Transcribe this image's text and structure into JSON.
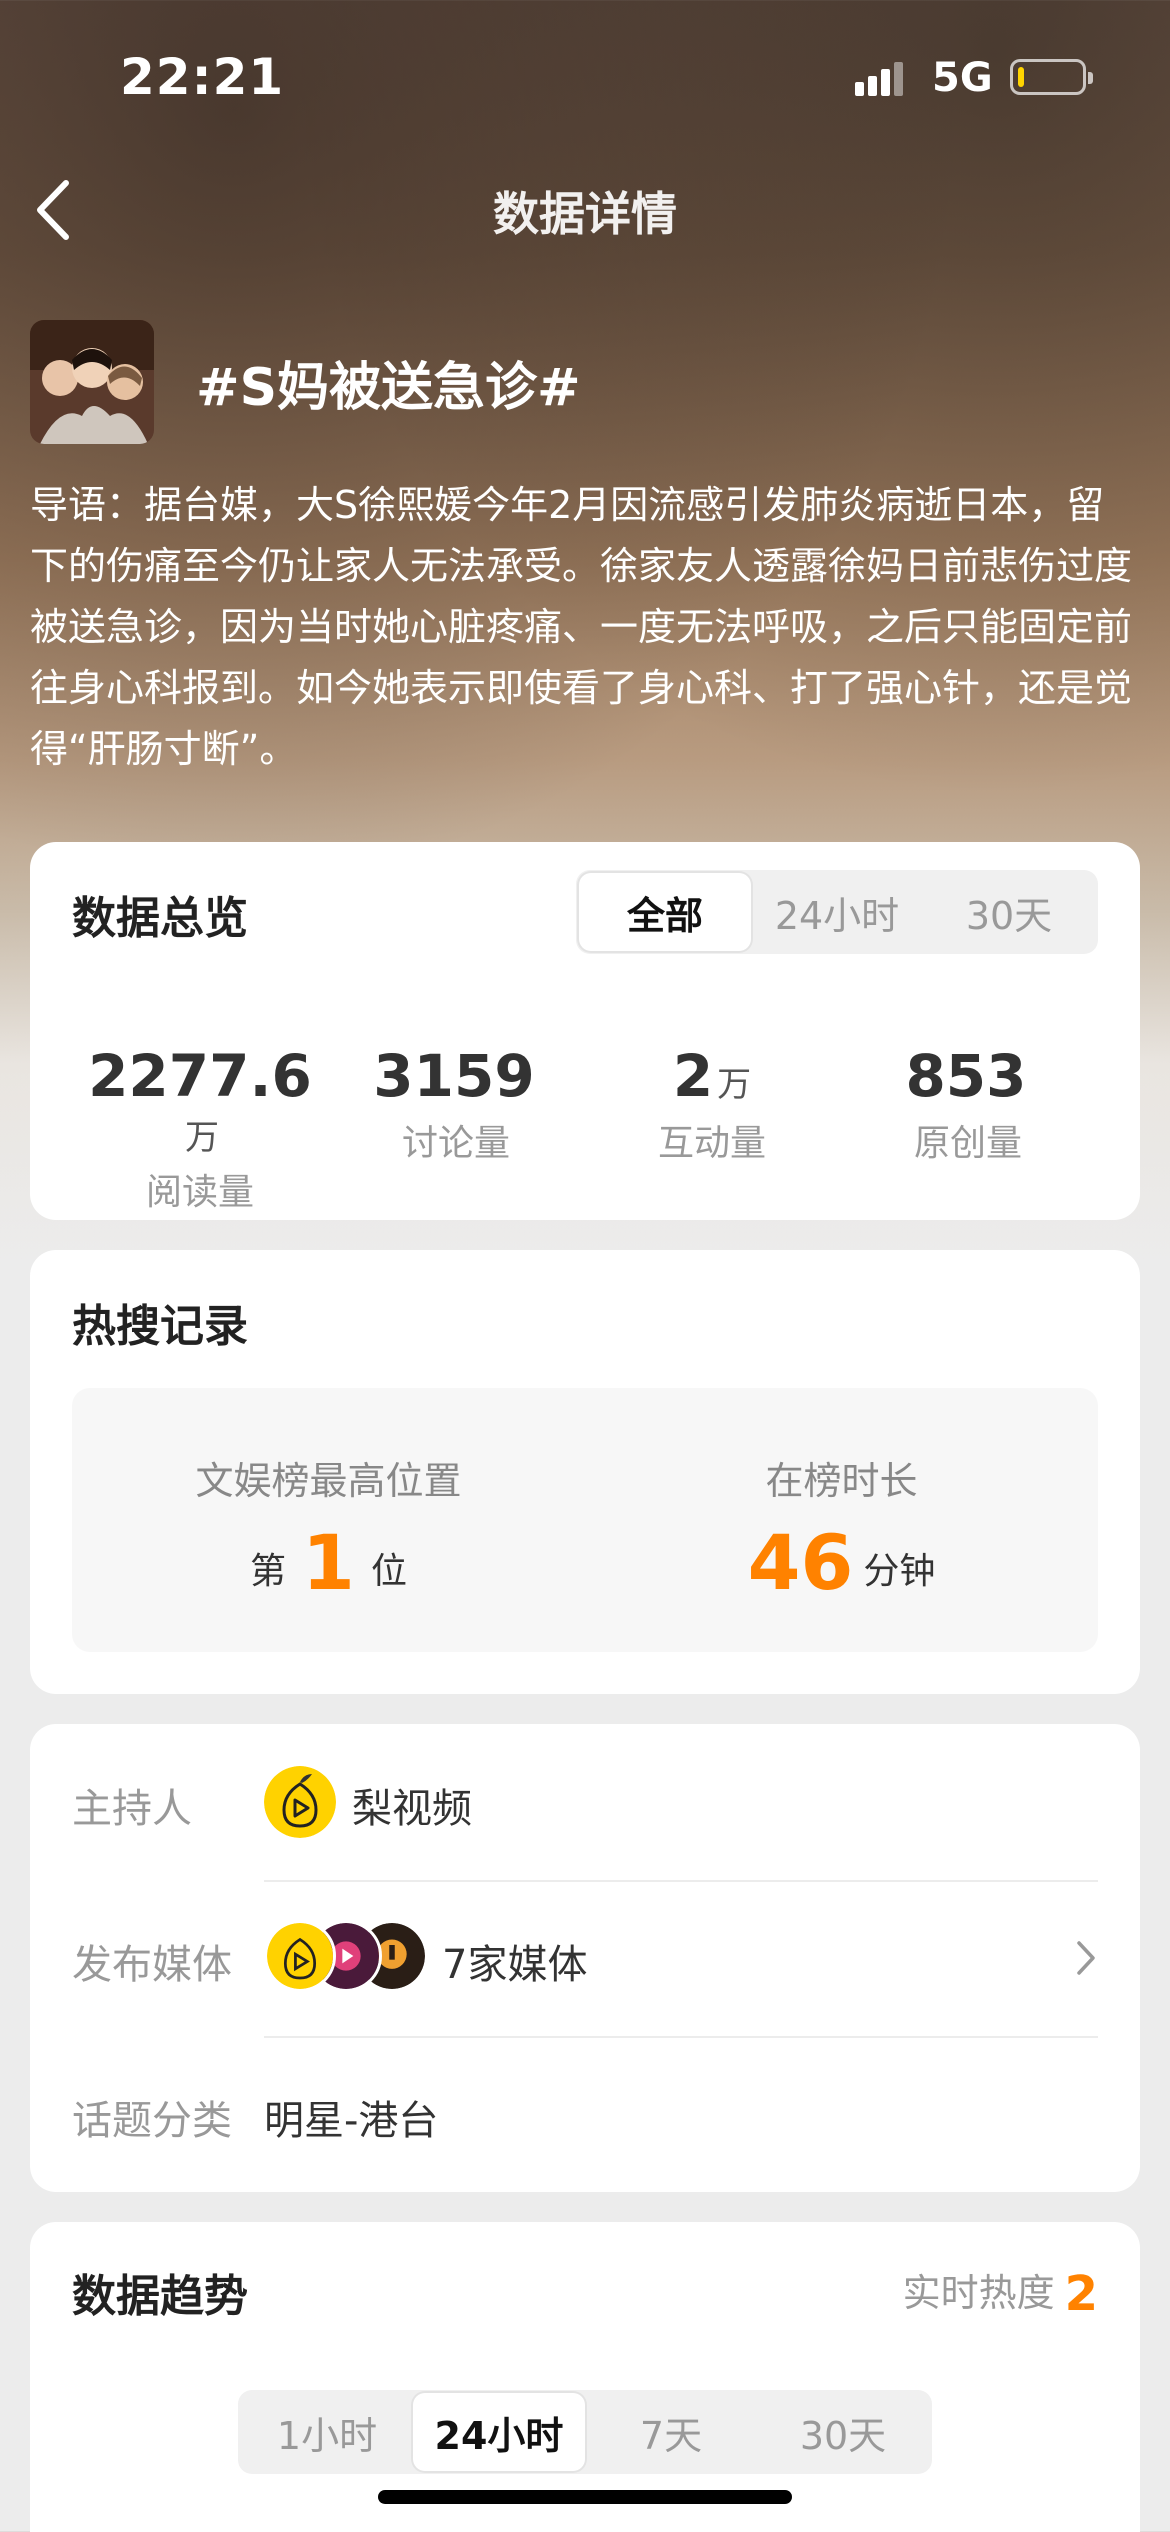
{
  "status_bar": {
    "time": "22:21",
    "network": "5G",
    "battery_level": 0.1
  },
  "nav": {
    "title": "数据详情"
  },
  "topic": {
    "title": "#S妈被送急诊#",
    "intro": "导语：据台媒，大S徐熙媛今年2月因流感引发肺炎病逝日本，留下的伤痛至今仍让家人无法承受。徐家友人透露徐妈日前悲伤过度被送急诊，因为当时她心脏疼痛、一度无法呼吸，之后只能固定前往身心科报到。如今她表示即使看了身心科、打了强心针，还是觉得“肝肠寸断”。"
  },
  "overview": {
    "title": "数据总览",
    "tabs": [
      "全部",
      "24小时",
      "30天"
    ],
    "active_tab": "全部",
    "stats": [
      {
        "value": "2277.6",
        "unit": "万",
        "label": "阅读量"
      },
      {
        "value": "3159",
        "unit": "",
        "label": "讨论量"
      },
      {
        "value": "2",
        "unit": "万",
        "label": "互动量"
      },
      {
        "value": "853",
        "unit": "",
        "label": "原创量"
      }
    ]
  },
  "hot_search": {
    "title": "热搜记录",
    "best_position_label": "文娱榜最高位置",
    "best_position_prefix": "第",
    "best_position_value": "1",
    "best_position_suffix": "位",
    "duration_label": "在榜时长",
    "duration_value": "46",
    "duration_unit": "分钟"
  },
  "info": {
    "host_label": "主持人",
    "host_name": "梨视频",
    "media_label": "发布媒体",
    "media_text": "7家媒体",
    "category_label": "话题分类",
    "category_value": "明星-港台"
  },
  "trend": {
    "title": "数据趋势",
    "realtime_label": "实时热度",
    "realtime_value": "2",
    "tabs": [
      "1小时",
      "24小时",
      "7天",
      "30天"
    ],
    "active_tab": "24小时"
  },
  "colors": {
    "accent": "#ff8200",
    "card_bg": "#ffffff",
    "page_bg": "#ececec"
  },
  "icons": [
    "back-chevron-icon",
    "signal-icon",
    "battery-icon",
    "pear-video-logo",
    "chevron-right-icon"
  ]
}
